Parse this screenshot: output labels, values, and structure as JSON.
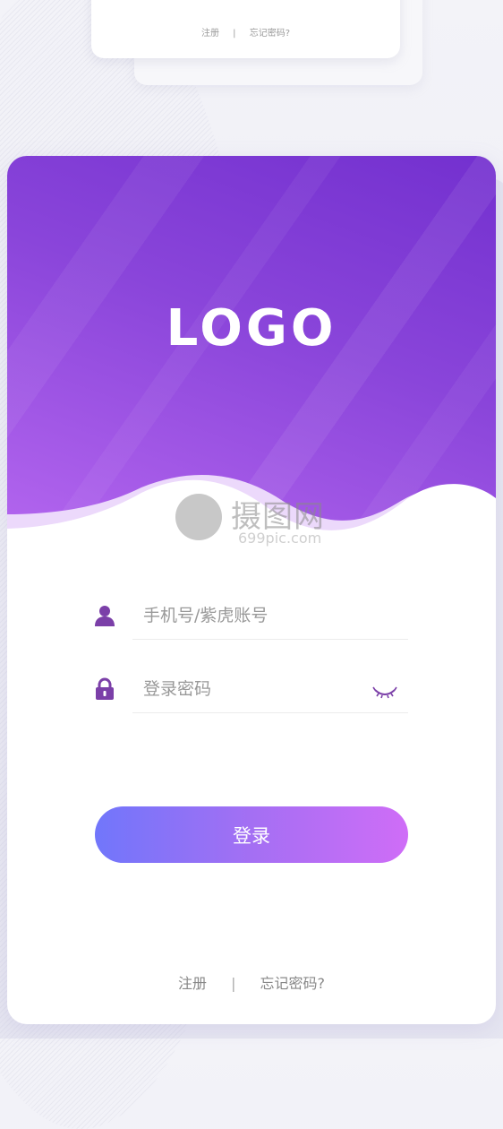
{
  "preview": {
    "register_label": "注册",
    "separator": "|",
    "forgot_label": "忘记密码?"
  },
  "header": {
    "logo_text": "LOGO"
  },
  "watermark": {
    "brand": "摄图网",
    "url": "699pic.com"
  },
  "form": {
    "username": {
      "icon": "user-icon",
      "placeholder": "手机号/紫虎账号",
      "value": ""
    },
    "password": {
      "icon": "lock-icon",
      "placeholder": "登录密码",
      "value": "",
      "toggle_icon": "eye-closed-icon"
    },
    "submit_label": "登录"
  },
  "footer": {
    "register_label": "注册",
    "separator": "|",
    "forgot_label": "忘记密码?"
  },
  "colors": {
    "primary": "#7b3fd6",
    "icon": "#7b3fa8",
    "button_start": "#7176fb",
    "button_end": "#cf6df7",
    "placeholder": "#999999"
  }
}
